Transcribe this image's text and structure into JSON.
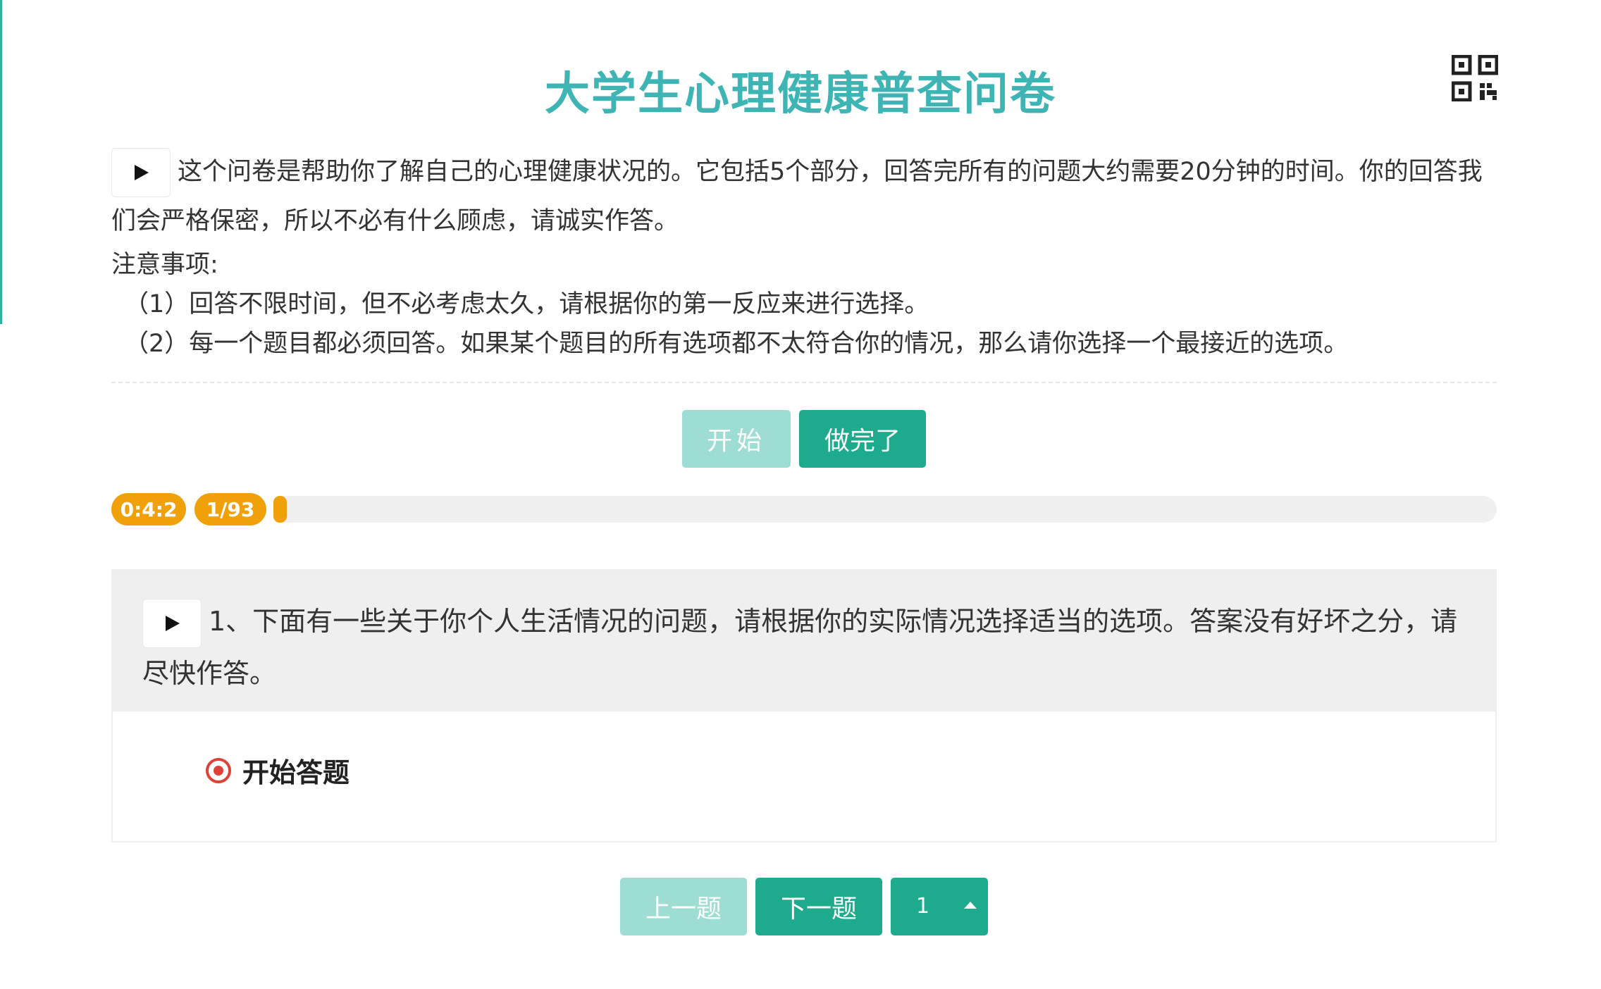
{
  "page": {
    "title": "大学生心理健康普查问卷"
  },
  "intro": {
    "description": "这个问卷是帮助你了解自己的心理健康状况的。它包括5个部分，回答完所有的问题大约需要20分钟的时间。你的回答我们会严格保密，所以不必有什么顾虑，请诚实作答。",
    "notes_title": "注意事项:",
    "notes": [
      "（1）回答不限时间，但不必考虑太久，请根据你的第一反应来进行选择。",
      "（2）每一个题目都必须回答。如果某个题目的所有选项都不太符合你的情况，那么请你选择一个最接近的选项。"
    ]
  },
  "controls": {
    "start_label": "开始",
    "done_label": "做完了"
  },
  "progress": {
    "timer": "0:4:2",
    "counter": "1/93",
    "current": 1,
    "total": 93
  },
  "question": {
    "text": "1、下面有一些关于你个人生活情况的问题，请根据你的实际情况选择适当的选项。答案没有好坏之分，请尽快作答。",
    "options": [
      {
        "label": "开始答题",
        "selected": true
      }
    ]
  },
  "navigation": {
    "prev_label": "上一题",
    "next_label": "下一题",
    "page_value": "1"
  },
  "colors": {
    "title": "#3fb4b4",
    "primary": "#1eaa8c",
    "primary_disabled": "#9dddd4",
    "badge": "#f0a10a",
    "selected_radio": "#e0403a"
  },
  "icons": {
    "qr": "qr-code-icon",
    "play": "play-icon",
    "radio": "radio-selected-icon",
    "caret": "caret-up-icon"
  }
}
